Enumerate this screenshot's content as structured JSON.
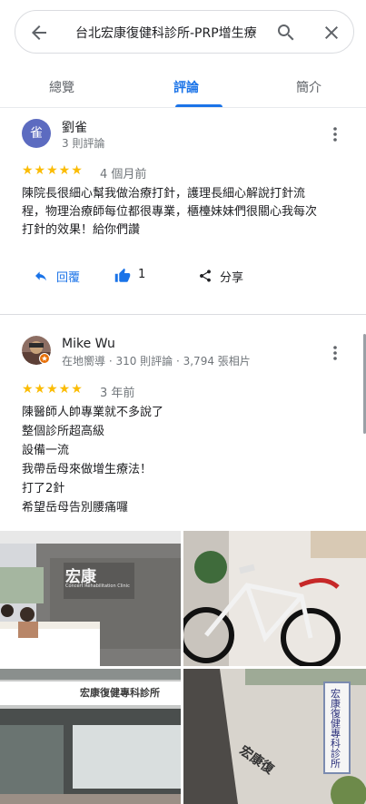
{
  "search": {
    "query": "台北宏康復健科診所-PRP增生療"
  },
  "tabs": [
    "總覽",
    "評論",
    "簡介"
  ],
  "reviews": [
    {
      "author": "劉雀",
      "avatar_letter": "雀",
      "meta": "3 則評論",
      "stars": "★★★★★",
      "rating": 5,
      "date": "4 個月前",
      "lines": [
        "陳院長很細心幫我做治療打針，護理長細心解說打針流",
        "程，物理治療師每位都很專業，櫃檯妹妹們很關心我每次",
        "打針的效果！給你們讚"
      ],
      "reply_label": "回覆",
      "like_count": "1",
      "share_label": "分享"
    },
    {
      "author": "Mike Wu",
      "meta": "在地嚮導 · 310 則評論 · 3,794 張相片",
      "stars": "★★★★★",
      "rating": 5,
      "date": "3 年前",
      "lines": [
        "陳醫師人帥專業就不多說了",
        "整個診所超高級",
        "設備一流",
        "我帶岳母來做增生療法！",
        "打了2針",
        "希望岳母告別腰痛囉"
      ]
    }
  ],
  "photos": {
    "logo_text": "宏康",
    "clinic_en": "Concert Rehabilitation Clinic",
    "sign_text": "宏康復健專科診所",
    "banner_text": "宏康復健專科診所",
    "brand_text": "宏康復"
  },
  "colors": {
    "accent": "#1a73e8",
    "star": "#fbbc04",
    "avatar": "#5c6bc0"
  }
}
